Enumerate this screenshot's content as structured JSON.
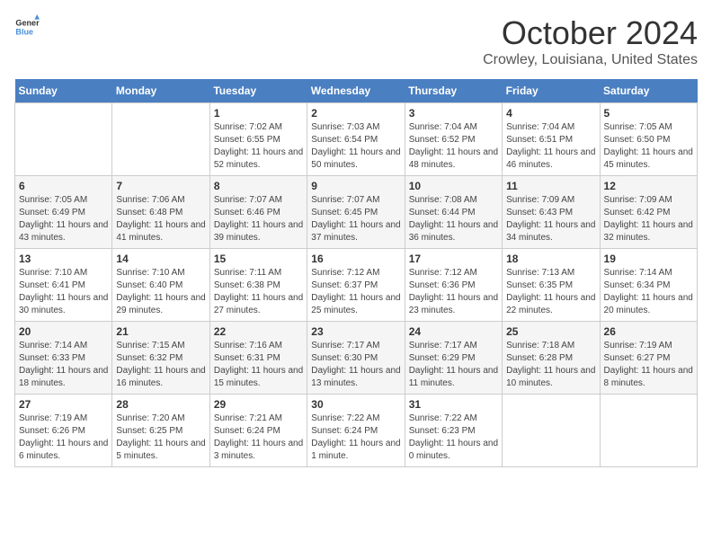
{
  "header": {
    "logo_general": "General",
    "logo_blue": "Blue",
    "month": "October 2024",
    "location": "Crowley, Louisiana, United States"
  },
  "weekdays": [
    "Sunday",
    "Monday",
    "Tuesday",
    "Wednesday",
    "Thursday",
    "Friday",
    "Saturday"
  ],
  "weeks": [
    [
      {
        "day": "",
        "sunrise": "",
        "sunset": "",
        "daylight": ""
      },
      {
        "day": "",
        "sunrise": "",
        "sunset": "",
        "daylight": ""
      },
      {
        "day": "1",
        "sunrise": "Sunrise: 7:02 AM",
        "sunset": "Sunset: 6:55 PM",
        "daylight": "Daylight: 11 hours and 52 minutes."
      },
      {
        "day": "2",
        "sunrise": "Sunrise: 7:03 AM",
        "sunset": "Sunset: 6:54 PM",
        "daylight": "Daylight: 11 hours and 50 minutes."
      },
      {
        "day": "3",
        "sunrise": "Sunrise: 7:04 AM",
        "sunset": "Sunset: 6:52 PM",
        "daylight": "Daylight: 11 hours and 48 minutes."
      },
      {
        "day": "4",
        "sunrise": "Sunrise: 7:04 AM",
        "sunset": "Sunset: 6:51 PM",
        "daylight": "Daylight: 11 hours and 46 minutes."
      },
      {
        "day": "5",
        "sunrise": "Sunrise: 7:05 AM",
        "sunset": "Sunset: 6:50 PM",
        "daylight": "Daylight: 11 hours and 45 minutes."
      }
    ],
    [
      {
        "day": "6",
        "sunrise": "Sunrise: 7:05 AM",
        "sunset": "Sunset: 6:49 PM",
        "daylight": "Daylight: 11 hours and 43 minutes."
      },
      {
        "day": "7",
        "sunrise": "Sunrise: 7:06 AM",
        "sunset": "Sunset: 6:48 PM",
        "daylight": "Daylight: 11 hours and 41 minutes."
      },
      {
        "day": "8",
        "sunrise": "Sunrise: 7:07 AM",
        "sunset": "Sunset: 6:46 PM",
        "daylight": "Daylight: 11 hours and 39 minutes."
      },
      {
        "day": "9",
        "sunrise": "Sunrise: 7:07 AM",
        "sunset": "Sunset: 6:45 PM",
        "daylight": "Daylight: 11 hours and 37 minutes."
      },
      {
        "day": "10",
        "sunrise": "Sunrise: 7:08 AM",
        "sunset": "Sunset: 6:44 PM",
        "daylight": "Daylight: 11 hours and 36 minutes."
      },
      {
        "day": "11",
        "sunrise": "Sunrise: 7:09 AM",
        "sunset": "Sunset: 6:43 PM",
        "daylight": "Daylight: 11 hours and 34 minutes."
      },
      {
        "day": "12",
        "sunrise": "Sunrise: 7:09 AM",
        "sunset": "Sunset: 6:42 PM",
        "daylight": "Daylight: 11 hours and 32 minutes."
      }
    ],
    [
      {
        "day": "13",
        "sunrise": "Sunrise: 7:10 AM",
        "sunset": "Sunset: 6:41 PM",
        "daylight": "Daylight: 11 hours and 30 minutes."
      },
      {
        "day": "14",
        "sunrise": "Sunrise: 7:10 AM",
        "sunset": "Sunset: 6:40 PM",
        "daylight": "Daylight: 11 hours and 29 minutes."
      },
      {
        "day": "15",
        "sunrise": "Sunrise: 7:11 AM",
        "sunset": "Sunset: 6:38 PM",
        "daylight": "Daylight: 11 hours and 27 minutes."
      },
      {
        "day": "16",
        "sunrise": "Sunrise: 7:12 AM",
        "sunset": "Sunset: 6:37 PM",
        "daylight": "Daylight: 11 hours and 25 minutes."
      },
      {
        "day": "17",
        "sunrise": "Sunrise: 7:12 AM",
        "sunset": "Sunset: 6:36 PM",
        "daylight": "Daylight: 11 hours and 23 minutes."
      },
      {
        "day": "18",
        "sunrise": "Sunrise: 7:13 AM",
        "sunset": "Sunset: 6:35 PM",
        "daylight": "Daylight: 11 hours and 22 minutes."
      },
      {
        "day": "19",
        "sunrise": "Sunrise: 7:14 AM",
        "sunset": "Sunset: 6:34 PM",
        "daylight": "Daylight: 11 hours and 20 minutes."
      }
    ],
    [
      {
        "day": "20",
        "sunrise": "Sunrise: 7:14 AM",
        "sunset": "Sunset: 6:33 PM",
        "daylight": "Daylight: 11 hours and 18 minutes."
      },
      {
        "day": "21",
        "sunrise": "Sunrise: 7:15 AM",
        "sunset": "Sunset: 6:32 PM",
        "daylight": "Daylight: 11 hours and 16 minutes."
      },
      {
        "day": "22",
        "sunrise": "Sunrise: 7:16 AM",
        "sunset": "Sunset: 6:31 PM",
        "daylight": "Daylight: 11 hours and 15 minutes."
      },
      {
        "day": "23",
        "sunrise": "Sunrise: 7:17 AM",
        "sunset": "Sunset: 6:30 PM",
        "daylight": "Daylight: 11 hours and 13 minutes."
      },
      {
        "day": "24",
        "sunrise": "Sunrise: 7:17 AM",
        "sunset": "Sunset: 6:29 PM",
        "daylight": "Daylight: 11 hours and 11 minutes."
      },
      {
        "day": "25",
        "sunrise": "Sunrise: 7:18 AM",
        "sunset": "Sunset: 6:28 PM",
        "daylight": "Daylight: 11 hours and 10 minutes."
      },
      {
        "day": "26",
        "sunrise": "Sunrise: 7:19 AM",
        "sunset": "Sunset: 6:27 PM",
        "daylight": "Daylight: 11 hours and 8 minutes."
      }
    ],
    [
      {
        "day": "27",
        "sunrise": "Sunrise: 7:19 AM",
        "sunset": "Sunset: 6:26 PM",
        "daylight": "Daylight: 11 hours and 6 minutes."
      },
      {
        "day": "28",
        "sunrise": "Sunrise: 7:20 AM",
        "sunset": "Sunset: 6:25 PM",
        "daylight": "Daylight: 11 hours and 5 minutes."
      },
      {
        "day": "29",
        "sunrise": "Sunrise: 7:21 AM",
        "sunset": "Sunset: 6:24 PM",
        "daylight": "Daylight: 11 hours and 3 minutes."
      },
      {
        "day": "30",
        "sunrise": "Sunrise: 7:22 AM",
        "sunset": "Sunset: 6:24 PM",
        "daylight": "Daylight: 11 hours and 1 minute."
      },
      {
        "day": "31",
        "sunrise": "Sunrise: 7:22 AM",
        "sunset": "Sunset: 6:23 PM",
        "daylight": "Daylight: 11 hours and 0 minutes."
      },
      {
        "day": "",
        "sunrise": "",
        "sunset": "",
        "daylight": ""
      },
      {
        "day": "",
        "sunrise": "",
        "sunset": "",
        "daylight": ""
      }
    ]
  ]
}
